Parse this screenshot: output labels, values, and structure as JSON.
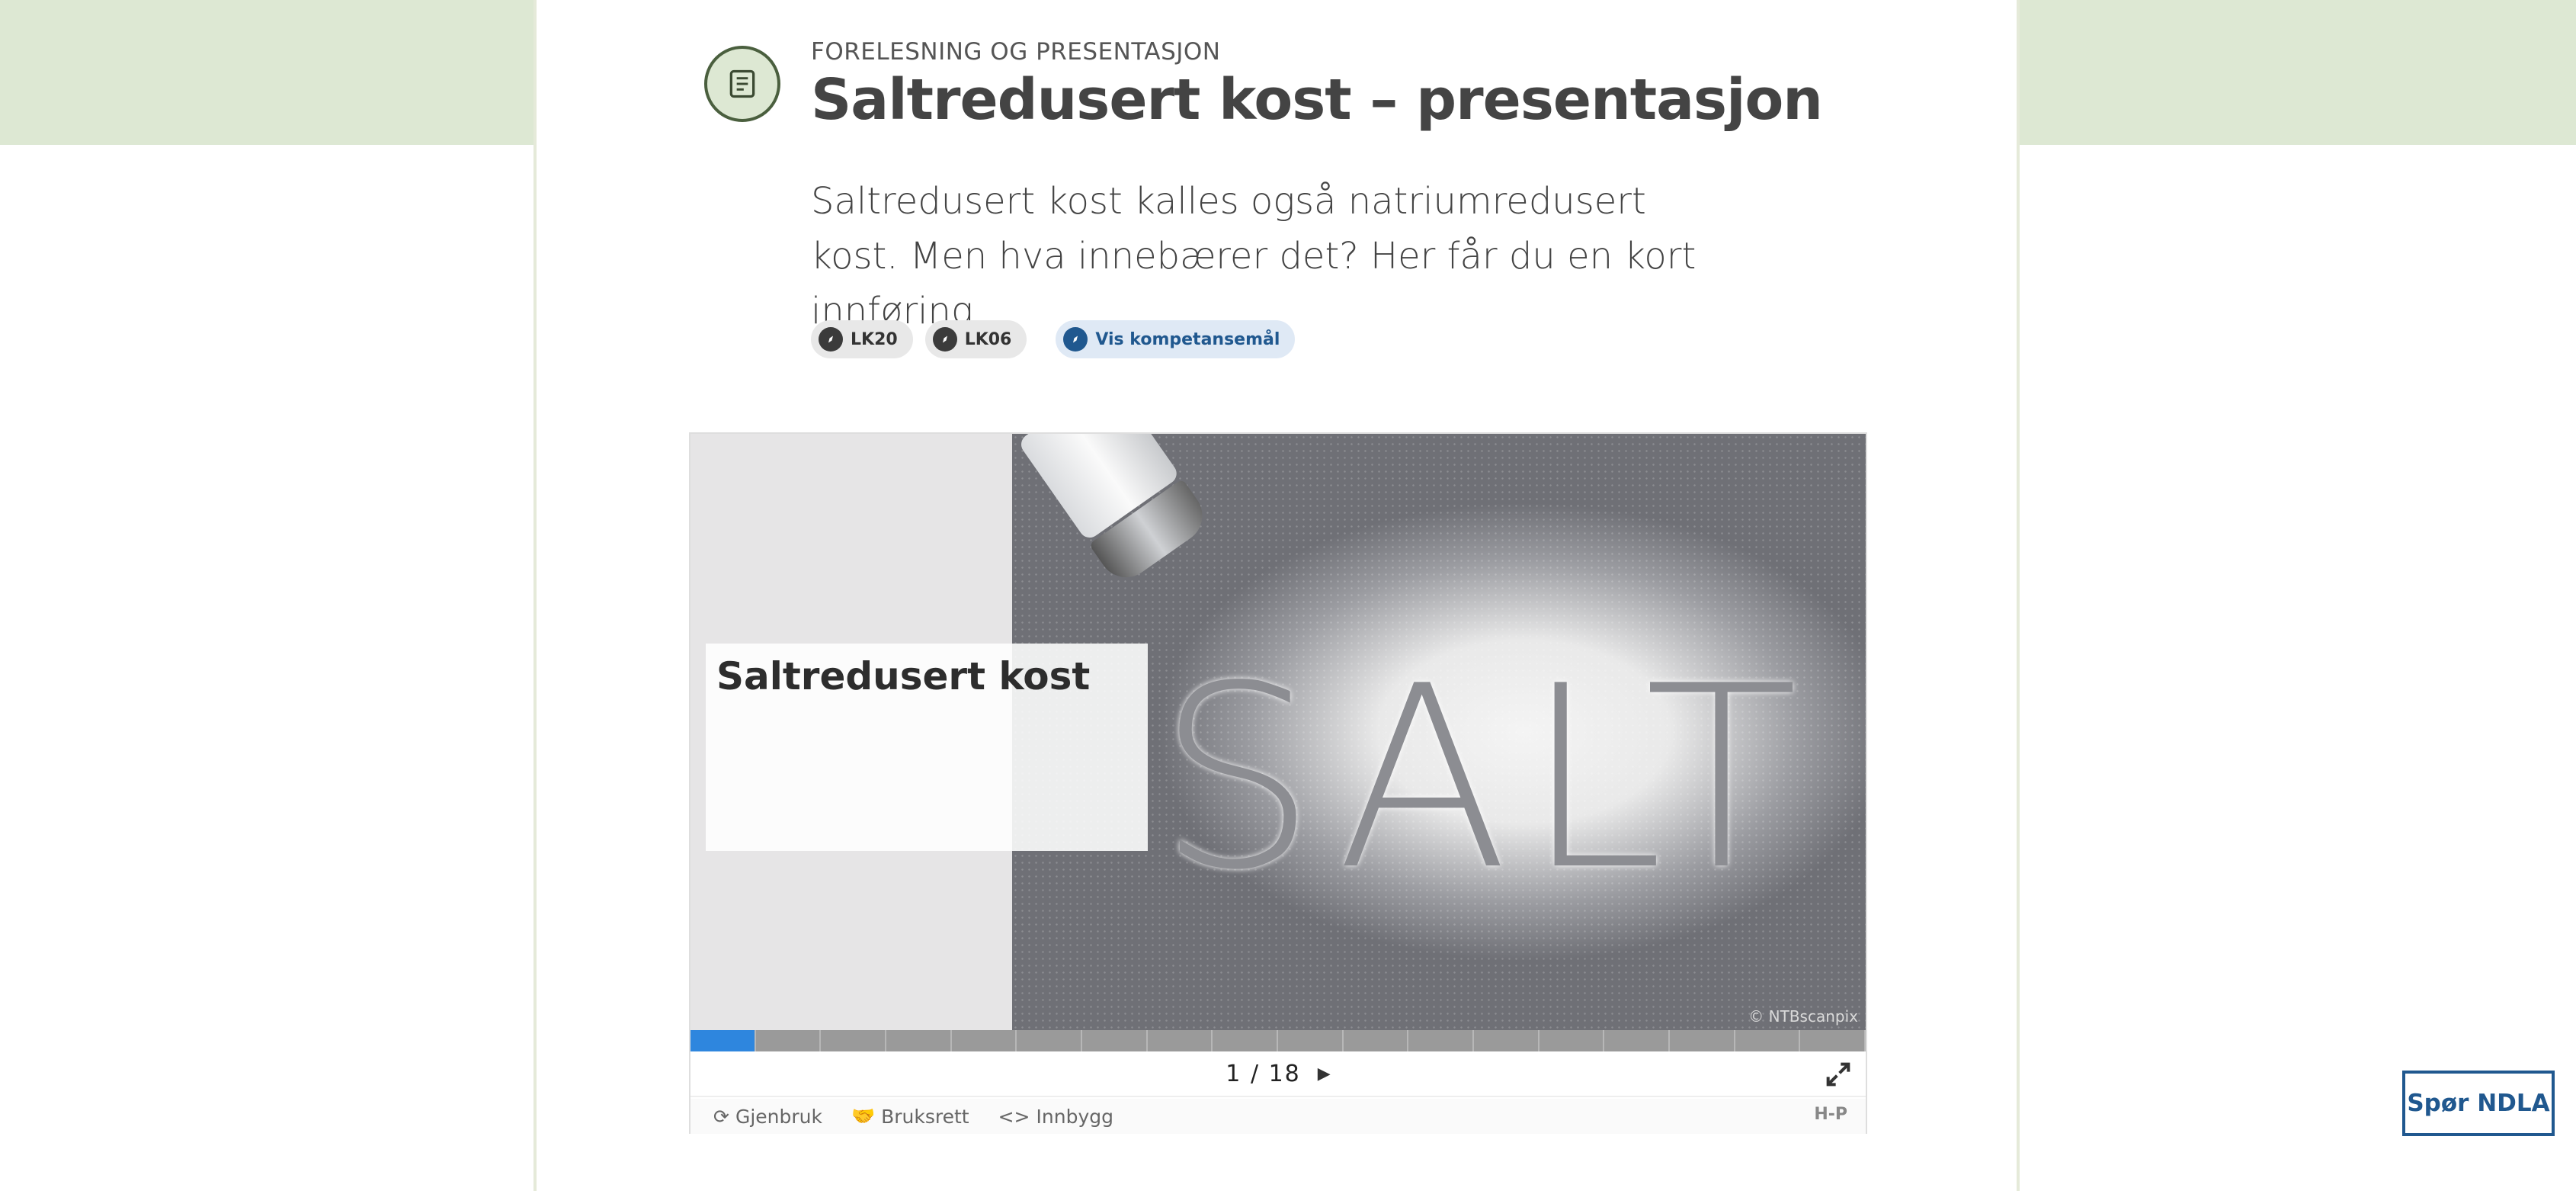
{
  "header": {
    "content_type": "FORELESNING OG PRESENTASJON",
    "title": "Saltredusert kost – presentasjon",
    "ingress": "Saltredusert kost kalles også natriumredusert kost. Men hva innebærer det? Her får du en kort innføring."
  },
  "tags": [
    {
      "label": "LK20"
    },
    {
      "label": "LK06"
    },
    {
      "label": "Vis kompetansemål"
    }
  ],
  "presentation": {
    "slide_title": "Saltredusert kost",
    "image_text": "SALT",
    "image_credit": "© NTBscanpix",
    "current_slide": "1",
    "separator": "/",
    "total_slides": "18",
    "progress": {
      "current": 1,
      "total": 18
    }
  },
  "footer": {
    "reuse": "Gjenbruk",
    "rights": "Bruksrett",
    "embed": "Innbygg",
    "brand": "H-P"
  },
  "ask_button": "Spør NDLA",
  "colors": {
    "hero_band": "#dde8d3",
    "accent_blue": "#20588f",
    "progress_active": "#2e86de"
  }
}
